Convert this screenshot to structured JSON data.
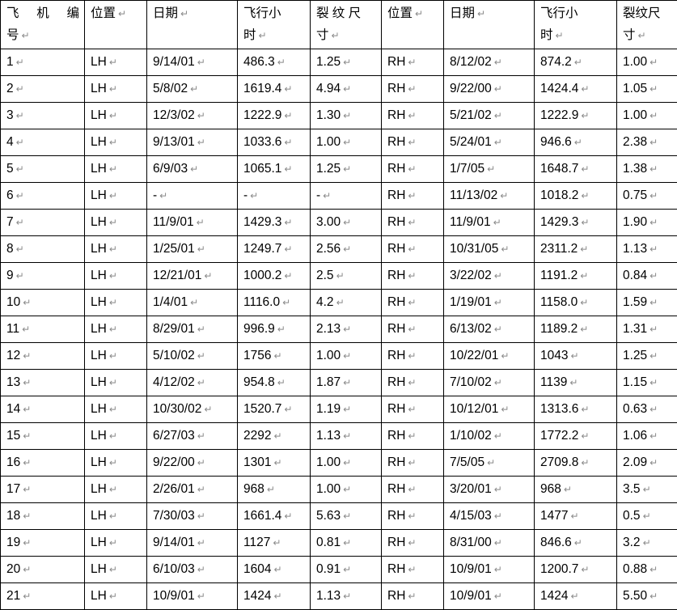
{
  "table": {
    "pilcrow_glyph": "↵",
    "headers": [
      {
        "text": "飞 机 编 号",
        "lines": [
          "飞 机 编",
          "号"
        ],
        "distributed": true
      },
      {
        "text": "位置",
        "lines": [
          "位置"
        ],
        "distributed": false
      },
      {
        "text": "日期",
        "lines": [
          "日期"
        ],
        "distributed": false
      },
      {
        "text": "飞行小时",
        "lines": [
          "飞行小",
          "时"
        ],
        "distributed": false
      },
      {
        "text": "裂纹尺寸",
        "lines": [
          "裂 纹 尺",
          "寸"
        ],
        "distributed": false
      },
      {
        "text": "位置",
        "lines": [
          "位置"
        ],
        "distributed": false
      },
      {
        "text": "日期",
        "lines": [
          "日期"
        ],
        "distributed": false
      },
      {
        "text": "飞行小时",
        "lines": [
          "飞行小",
          "时"
        ],
        "distributed": false
      },
      {
        "text": "裂纹尺寸",
        "lines": [
          "裂纹尺",
          "寸"
        ],
        "distributed": false
      }
    ],
    "rows": [
      {
        "aircraft_no": "1",
        "lh_position": "LH",
        "lh_date": "9/14/01",
        "lh_hours": "486.3",
        "lh_crack": "1.25",
        "rh_position": "RH",
        "rh_date": "8/12/02",
        "rh_hours": "874.2",
        "rh_crack": "1.00"
      },
      {
        "aircraft_no": "2",
        "lh_position": "LH",
        "lh_date": "5/8/02",
        "lh_hours": "1619.4",
        "lh_crack": "4.94",
        "rh_position": "RH",
        "rh_date": "9/22/00",
        "rh_hours": "1424.4",
        "rh_crack": "1.05"
      },
      {
        "aircraft_no": "3",
        "lh_position": "LH",
        "lh_date": "12/3/02",
        "lh_hours": "1222.9",
        "lh_crack": "1.30",
        "rh_position": "RH",
        "rh_date": "5/21/02",
        "rh_hours": "1222.9",
        "rh_crack": "1.00"
      },
      {
        "aircraft_no": "4",
        "lh_position": "LH",
        "lh_date": "9/13/01",
        "lh_hours": "1033.6",
        "lh_crack": "1.00",
        "rh_position": "RH",
        "rh_date": "5/24/01",
        "rh_hours": "946.6",
        "rh_crack": "2.38"
      },
      {
        "aircraft_no": "5",
        "lh_position": "LH",
        "lh_date": "6/9/03",
        "lh_hours": "1065.1",
        "lh_crack": "1.25",
        "rh_position": "RH",
        "rh_date": "1/7/05",
        "rh_hours": "1648.7",
        "rh_crack": "1.38"
      },
      {
        "aircraft_no": "6",
        "lh_position": "LH",
        "lh_date": "-",
        "lh_hours": "-",
        "lh_crack": "-",
        "rh_position": "RH",
        "rh_date": "11/13/02",
        "rh_hours": "1018.2",
        "rh_crack": "0.75"
      },
      {
        "aircraft_no": "7",
        "lh_position": "LH",
        "lh_date": "11/9/01",
        "lh_hours": "1429.3",
        "lh_crack": "3.00",
        "rh_position": "RH",
        "rh_date": "11/9/01",
        "rh_hours": "1429.3",
        "rh_crack": "1.90"
      },
      {
        "aircraft_no": "8",
        "lh_position": "LH",
        "lh_date": "1/25/01",
        "lh_hours": "1249.7",
        "lh_crack": "2.56",
        "rh_position": "RH",
        "rh_date": "10/31/05",
        "rh_hours": "2311.2",
        "rh_crack": "1.13"
      },
      {
        "aircraft_no": "9",
        "lh_position": "LH",
        "lh_date": "12/21/01",
        "lh_hours": "1000.2",
        "lh_crack": "2.5",
        "rh_position": "RH",
        "rh_date": "3/22/02",
        "rh_hours": "1191.2",
        "rh_crack": "0.84"
      },
      {
        "aircraft_no": "10",
        "lh_position": "LH",
        "lh_date": "1/4/01",
        "lh_hours": "1116.0",
        "lh_crack": "4.2",
        "rh_position": "RH",
        "rh_date": "1/19/01",
        "rh_hours": "1158.0",
        "rh_crack": "1.59"
      },
      {
        "aircraft_no": "11",
        "lh_position": "LH",
        "lh_date": "8/29/01",
        "lh_hours": "996.9",
        "lh_crack": "2.13",
        "rh_position": "RH",
        "rh_date": "6/13/02",
        "rh_hours": "1189.2",
        "rh_crack": "1.31"
      },
      {
        "aircraft_no": "12",
        "lh_position": "LH",
        "lh_date": "5/10/02",
        "lh_hours": "1756",
        "lh_crack": "1.00",
        "rh_position": "RH",
        "rh_date": "10/22/01",
        "rh_hours": "1043",
        "rh_crack": "1.25"
      },
      {
        "aircraft_no": "13",
        "lh_position": "LH",
        "lh_date": "4/12/02",
        "lh_hours": "954.8",
        "lh_crack": "1.87",
        "rh_position": "RH",
        "rh_date": "7/10/02",
        "rh_hours": "1139",
        "rh_crack": "1.15"
      },
      {
        "aircraft_no": "14",
        "lh_position": "LH",
        "lh_date": "10/30/02",
        "lh_hours": "1520.7",
        "lh_crack": "1.19",
        "rh_position": "RH",
        "rh_date": "10/12/01",
        "rh_hours": "1313.6",
        "rh_crack": "0.63"
      },
      {
        "aircraft_no": "15",
        "lh_position": "LH",
        "lh_date": "6/27/03",
        "lh_hours": "2292",
        "lh_crack": "1.13",
        "rh_position": "RH",
        "rh_date": "1/10/02",
        "rh_hours": "1772.2",
        "rh_crack": "1.06"
      },
      {
        "aircraft_no": "16",
        "lh_position": "LH",
        "lh_date": "9/22/00",
        "lh_hours": "1301",
        "lh_crack": "1.00",
        "rh_position": "RH",
        "rh_date": "7/5/05",
        "rh_hours": "2709.8",
        "rh_crack": "2.09"
      },
      {
        "aircraft_no": "17",
        "lh_position": "LH",
        "lh_date": "2/26/01",
        "lh_hours": "968",
        "lh_crack": "1.00",
        "rh_position": "RH",
        "rh_date": "3/20/01",
        "rh_hours": "968",
        "rh_crack": "3.5"
      },
      {
        "aircraft_no": "18",
        "lh_position": "LH",
        "lh_date": "7/30/03",
        "lh_hours": "1661.4",
        "lh_crack": "5.63",
        "rh_position": "RH",
        "rh_date": "4/15/03",
        "rh_hours": "1477",
        "rh_crack": "0.5"
      },
      {
        "aircraft_no": "19",
        "lh_position": "LH",
        "lh_date": "9/14/01",
        "lh_hours": "1127",
        "lh_crack": "0.81",
        "rh_position": "RH",
        "rh_date": "8/31/00",
        "rh_hours": "846.6",
        "rh_crack": "3.2"
      },
      {
        "aircraft_no": "20",
        "lh_position": "LH",
        "lh_date": "6/10/03",
        "lh_hours": "1604",
        "lh_crack": "0.91",
        "rh_position": "RH",
        "rh_date": "10/9/01",
        "rh_hours": "1200.7",
        "rh_crack": "0.88"
      },
      {
        "aircraft_no": "21",
        "lh_position": "LH",
        "lh_date": "10/9/01",
        "lh_hours": "1424",
        "lh_crack": "1.13",
        "rh_position": "RH",
        "rh_date": "10/9/01",
        "rh_hours": "1424",
        "rh_crack": "5.50"
      }
    ]
  }
}
